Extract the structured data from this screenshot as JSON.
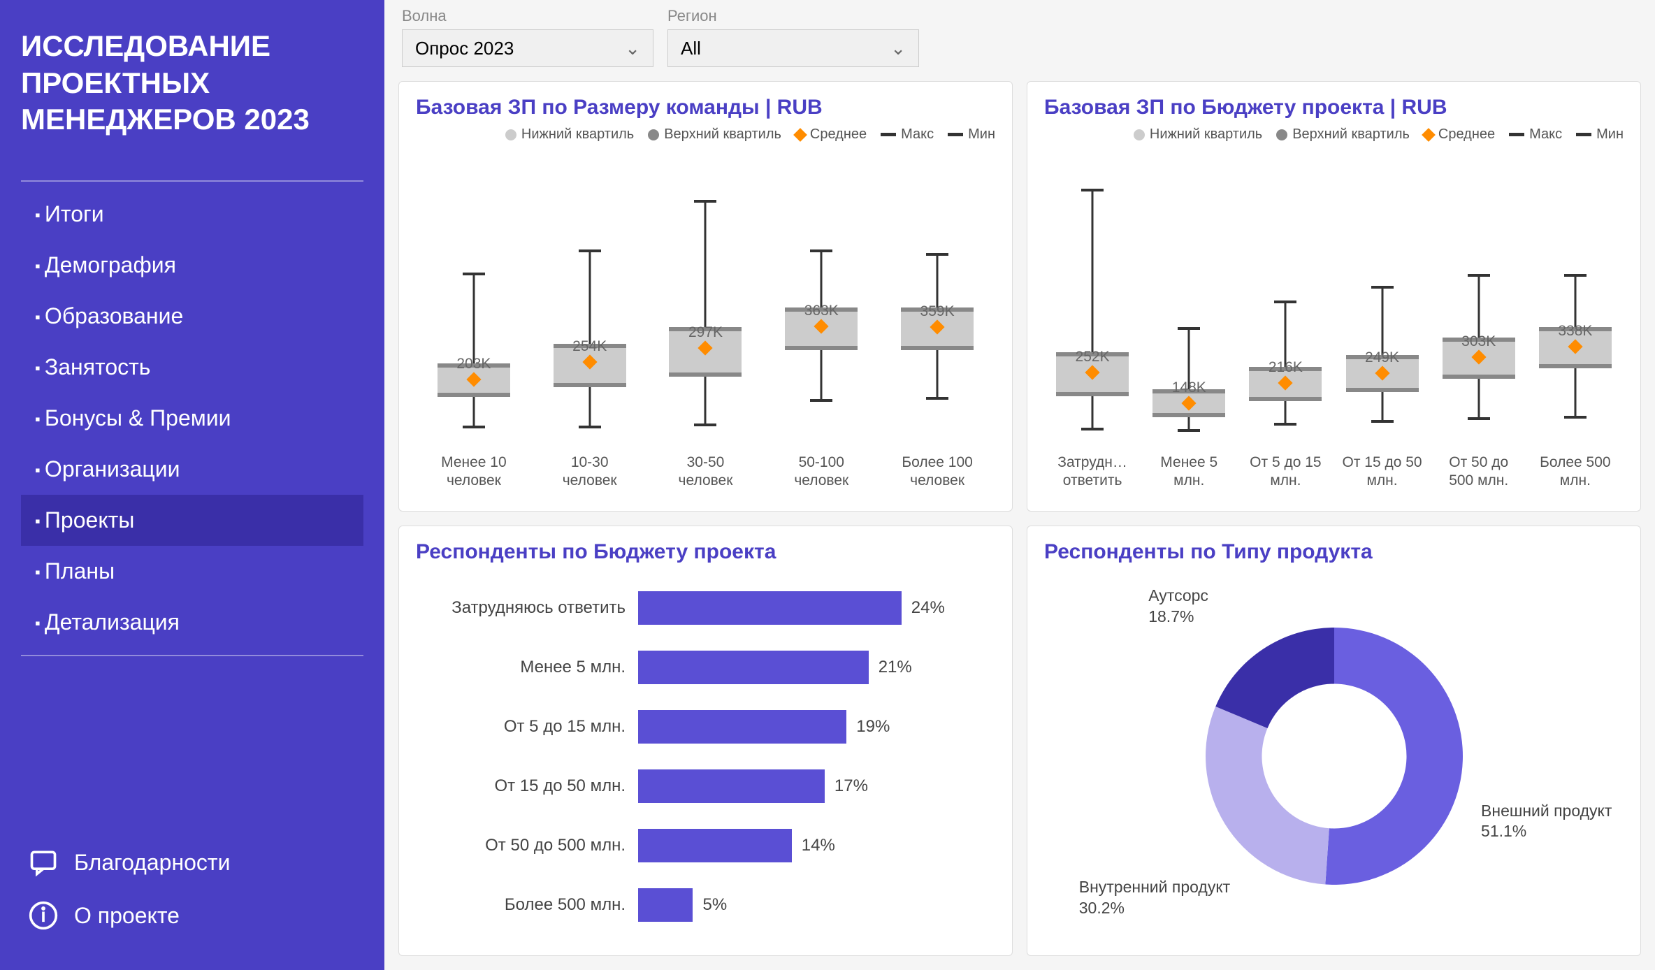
{
  "sidebar": {
    "title": "ИССЛЕДОВАНИЕ ПРОЕКТНЫХ МЕНЕДЖЕРОВ 2023",
    "nav": [
      "Итоги",
      "Демография",
      "Образование",
      "Занятость",
      "Бонусы & Премии",
      "Организации",
      "Проекты",
      "Планы",
      "Детализация"
    ],
    "active_index": 6,
    "footer": {
      "thanks": "Благодарности",
      "about": "О проекте"
    }
  },
  "filters": {
    "wave": {
      "label": "Волна",
      "value": "Опрос 2023"
    },
    "region": {
      "label": "Регион",
      "value": "All"
    }
  },
  "legend": {
    "lower_q": "Нижний квартиль",
    "upper_q": "Верхний квартиль",
    "mean": "Среднее",
    "max": "Макс",
    "min": "Мин"
  },
  "cards": {
    "team": {
      "title": "Базовая ЗП по Размеру команды | RUB"
    },
    "budget_box": {
      "title": "Базовая ЗП по Бюджету проекта | RUB"
    },
    "budget_bar": {
      "title": "Респонденты по Бюджету проекта"
    },
    "product": {
      "title": "Респонденты по Типу продукта"
    }
  },
  "chart_data": [
    {
      "id": "team",
      "type": "boxplot",
      "title": "Базовая ЗП по Размеру команды | RUB",
      "ylabel": "RUB",
      "ylim": [
        0,
        800
      ],
      "categories": [
        "Менее 10 человек",
        "10-30 человек",
        "30-50 человек",
        "50-100 человек",
        "Более 100 человек"
      ],
      "series": [
        {
          "mean": 203,
          "mean_label": "203K",
          "min": 60,
          "max": 520,
          "q1": 150,
          "q3": 250
        },
        {
          "mean": 254,
          "mean_label": "254K",
          "min": 60,
          "max": 590,
          "q1": 180,
          "q3": 310
        },
        {
          "mean": 297,
          "mean_label": "297K",
          "min": 65,
          "max": 740,
          "q1": 210,
          "q3": 360
        },
        {
          "mean": 363,
          "mean_label": "363K",
          "min": 140,
          "max": 590,
          "q1": 290,
          "q3": 420
        },
        {
          "mean": 359,
          "mean_label": "359K",
          "min": 145,
          "max": 580,
          "q1": 290,
          "q3": 420
        }
      ]
    },
    {
      "id": "budget_box",
      "type": "boxplot",
      "title": "Базовая ЗП по Бюджету проекта | RUB",
      "ylabel": "RUB",
      "ylim": [
        0,
        900
      ],
      "categories": [
        "Затрудн… ответить",
        "Менее 5 млн.",
        "От 5 до 15 млн.",
        "От 15 до 50 млн.",
        "От 50 до 500 млн.",
        "Более 500 млн."
      ],
      "series": [
        {
          "mean": 252,
          "mean_label": "252K",
          "min": 60,
          "max": 870,
          "q1": 170,
          "q3": 320
        },
        {
          "mean": 148,
          "mean_label": "148K",
          "min": 55,
          "max": 400,
          "q1": 100,
          "q3": 195
        },
        {
          "mean": 216,
          "mean_label": "216K",
          "min": 75,
          "max": 490,
          "q1": 155,
          "q3": 270
        },
        {
          "mean": 249,
          "mean_label": "249K",
          "min": 85,
          "max": 540,
          "q1": 185,
          "q3": 310
        },
        {
          "mean": 303,
          "mean_label": "303K",
          "min": 95,
          "max": 580,
          "q1": 230,
          "q3": 370
        },
        {
          "mean": 338,
          "mean_label": "338K",
          "min": 100,
          "max": 580,
          "q1": 265,
          "q3": 405
        }
      ]
    },
    {
      "id": "budget_bar",
      "type": "bar",
      "orientation": "horizontal",
      "title": "Респонденты по Бюджету проекта",
      "xlabel": "%",
      "xlim": [
        0,
        30
      ],
      "categories": [
        "Затрудняюсь ответить",
        "Менее 5 млн.",
        "От 5 до 15 млн.",
        "От 15 до 50 млн.",
        "От 50 до 500 млн.",
        "Более 500 млн."
      ],
      "values": [
        24,
        21,
        19,
        17,
        14,
        5
      ],
      "value_labels": [
        "24%",
        "21%",
        "19%",
        "17%",
        "14%",
        "5%"
      ]
    },
    {
      "id": "product",
      "type": "pie",
      "subtype": "donut",
      "title": "Респонденты по Типу продукта",
      "categories": [
        "Внешний продукт",
        "Внутренний продукт",
        "Аутсорс"
      ],
      "values": [
        51.1,
        30.2,
        18.7
      ],
      "value_labels": [
        "Внешний продукт 51.1%",
        "Внутренний продукт 30.2%",
        "Аутсорс 18.7%"
      ],
      "colors": [
        "#6a5fe0",
        "#b8b0ed",
        "#3a2fa8"
      ]
    }
  ]
}
